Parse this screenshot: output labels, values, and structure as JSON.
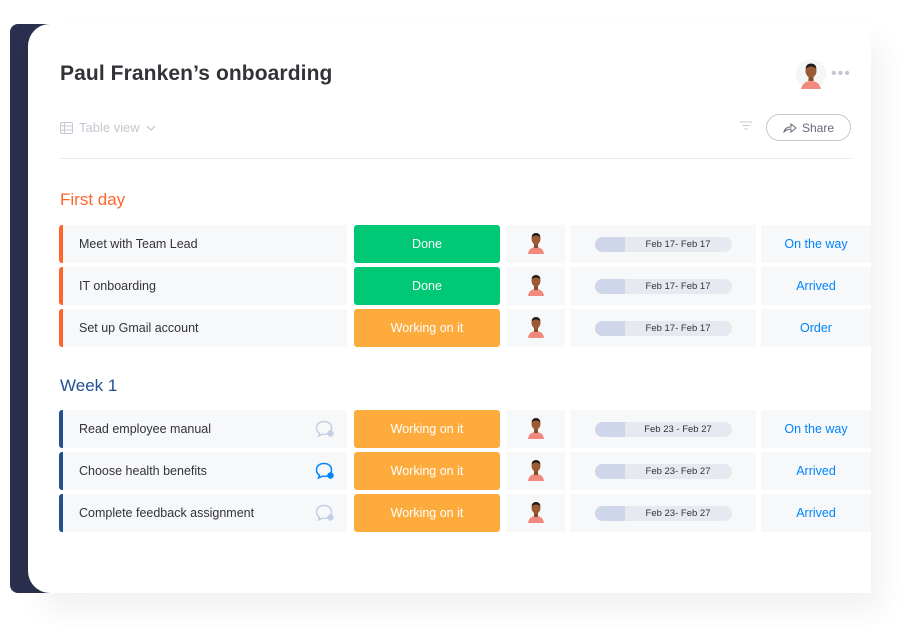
{
  "header": {
    "title": "Paul Franken’s onboarding",
    "more_label": "•••",
    "view_label": "Table view",
    "share_label": "Share"
  },
  "colors": {
    "first_day_accent": "#ff642e",
    "week1_accent": "#225091",
    "done": "#00c875",
    "working": "#fdab3d",
    "link": "#0085ff"
  },
  "groups": [
    {
      "title": "First day",
      "rows": [
        {
          "name": "Meet with Team Lead",
          "comment": "none",
          "status": "Done",
          "timeline": "Feb 17- Feb 17",
          "tracking": "On the way"
        },
        {
          "name": "IT onboarding",
          "comment": "none",
          "status": "Done",
          "timeline": "Feb 17- Feb 17",
          "tracking": "Arrived"
        },
        {
          "name": "Set up Gmail account",
          "comment": "none",
          "status": "Working on it",
          "timeline": "Feb 17- Feb 17",
          "tracking": "Order"
        }
      ]
    },
    {
      "title": "Week 1",
      "rows": [
        {
          "name": "Read employee manual",
          "comment": "inactive",
          "status": "Working on it",
          "timeline": "Feb 23 - Feb 27",
          "tracking": "On the way"
        },
        {
          "name": "Choose health benefits",
          "comment": "active",
          "status": "Working on it",
          "timeline": "Feb 23- Feb 27",
          "tracking": "Arrived"
        },
        {
          "name": "Complete feedback assignment",
          "comment": "inactive",
          "status": "Working on it",
          "timeline": "Feb 23- Feb 27",
          "tracking": "Arrived"
        }
      ]
    }
  ]
}
